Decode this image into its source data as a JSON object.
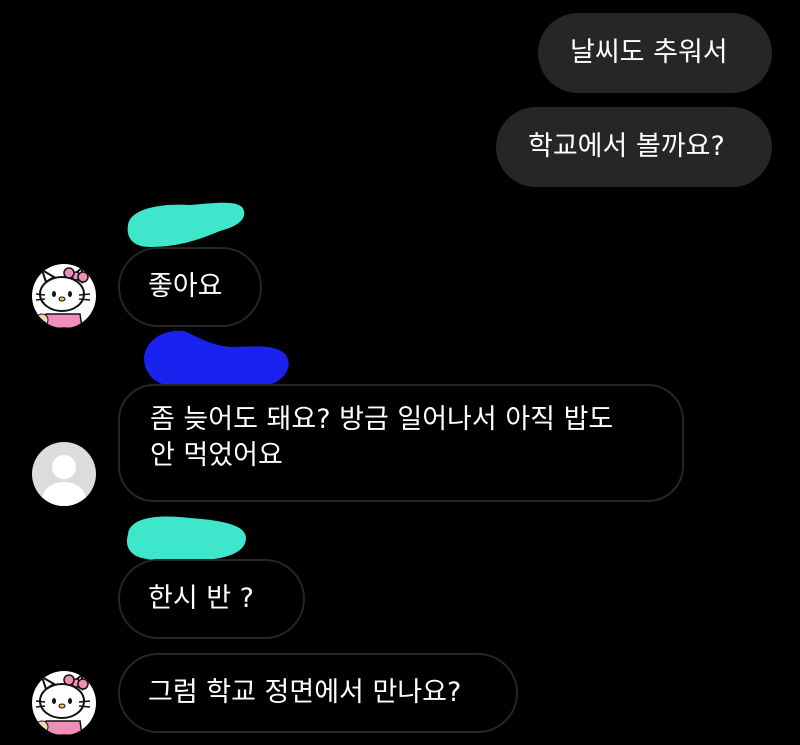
{
  "messages": [
    {
      "id": "m1",
      "direction": "sent",
      "text": "날씨도 추워서"
    },
    {
      "id": "m2",
      "direction": "sent",
      "text": "학교에서 볼까요?"
    },
    {
      "id": "m3",
      "direction": "received",
      "sender": "redacted-name-1",
      "avatar": "hello-kitty-avatar",
      "text": "좋아요"
    },
    {
      "id": "m4",
      "direction": "received",
      "sender": "redacted-name-2",
      "avatar": "default-avatar",
      "lines": [
        "좀 늦어도 돼요? 방금 일어나서 아직 밥도",
        "안 먹었어요"
      ]
    },
    {
      "id": "m5",
      "direction": "received",
      "sender": "redacted-name-1",
      "text": "한시 반 ?"
    },
    {
      "id": "m6",
      "direction": "received",
      "sender": "redacted-name-1",
      "avatar": "hello-kitty-avatar",
      "text": "그럼 학교 정면에서 만나요?"
    }
  ],
  "colors": {
    "background": "#000000",
    "sent_bubble": "#262626",
    "received_border": "#262626",
    "text": "#ffffff",
    "redaction_teal": "#3ee6cc",
    "redaction_blue": "#1a22f0"
  }
}
